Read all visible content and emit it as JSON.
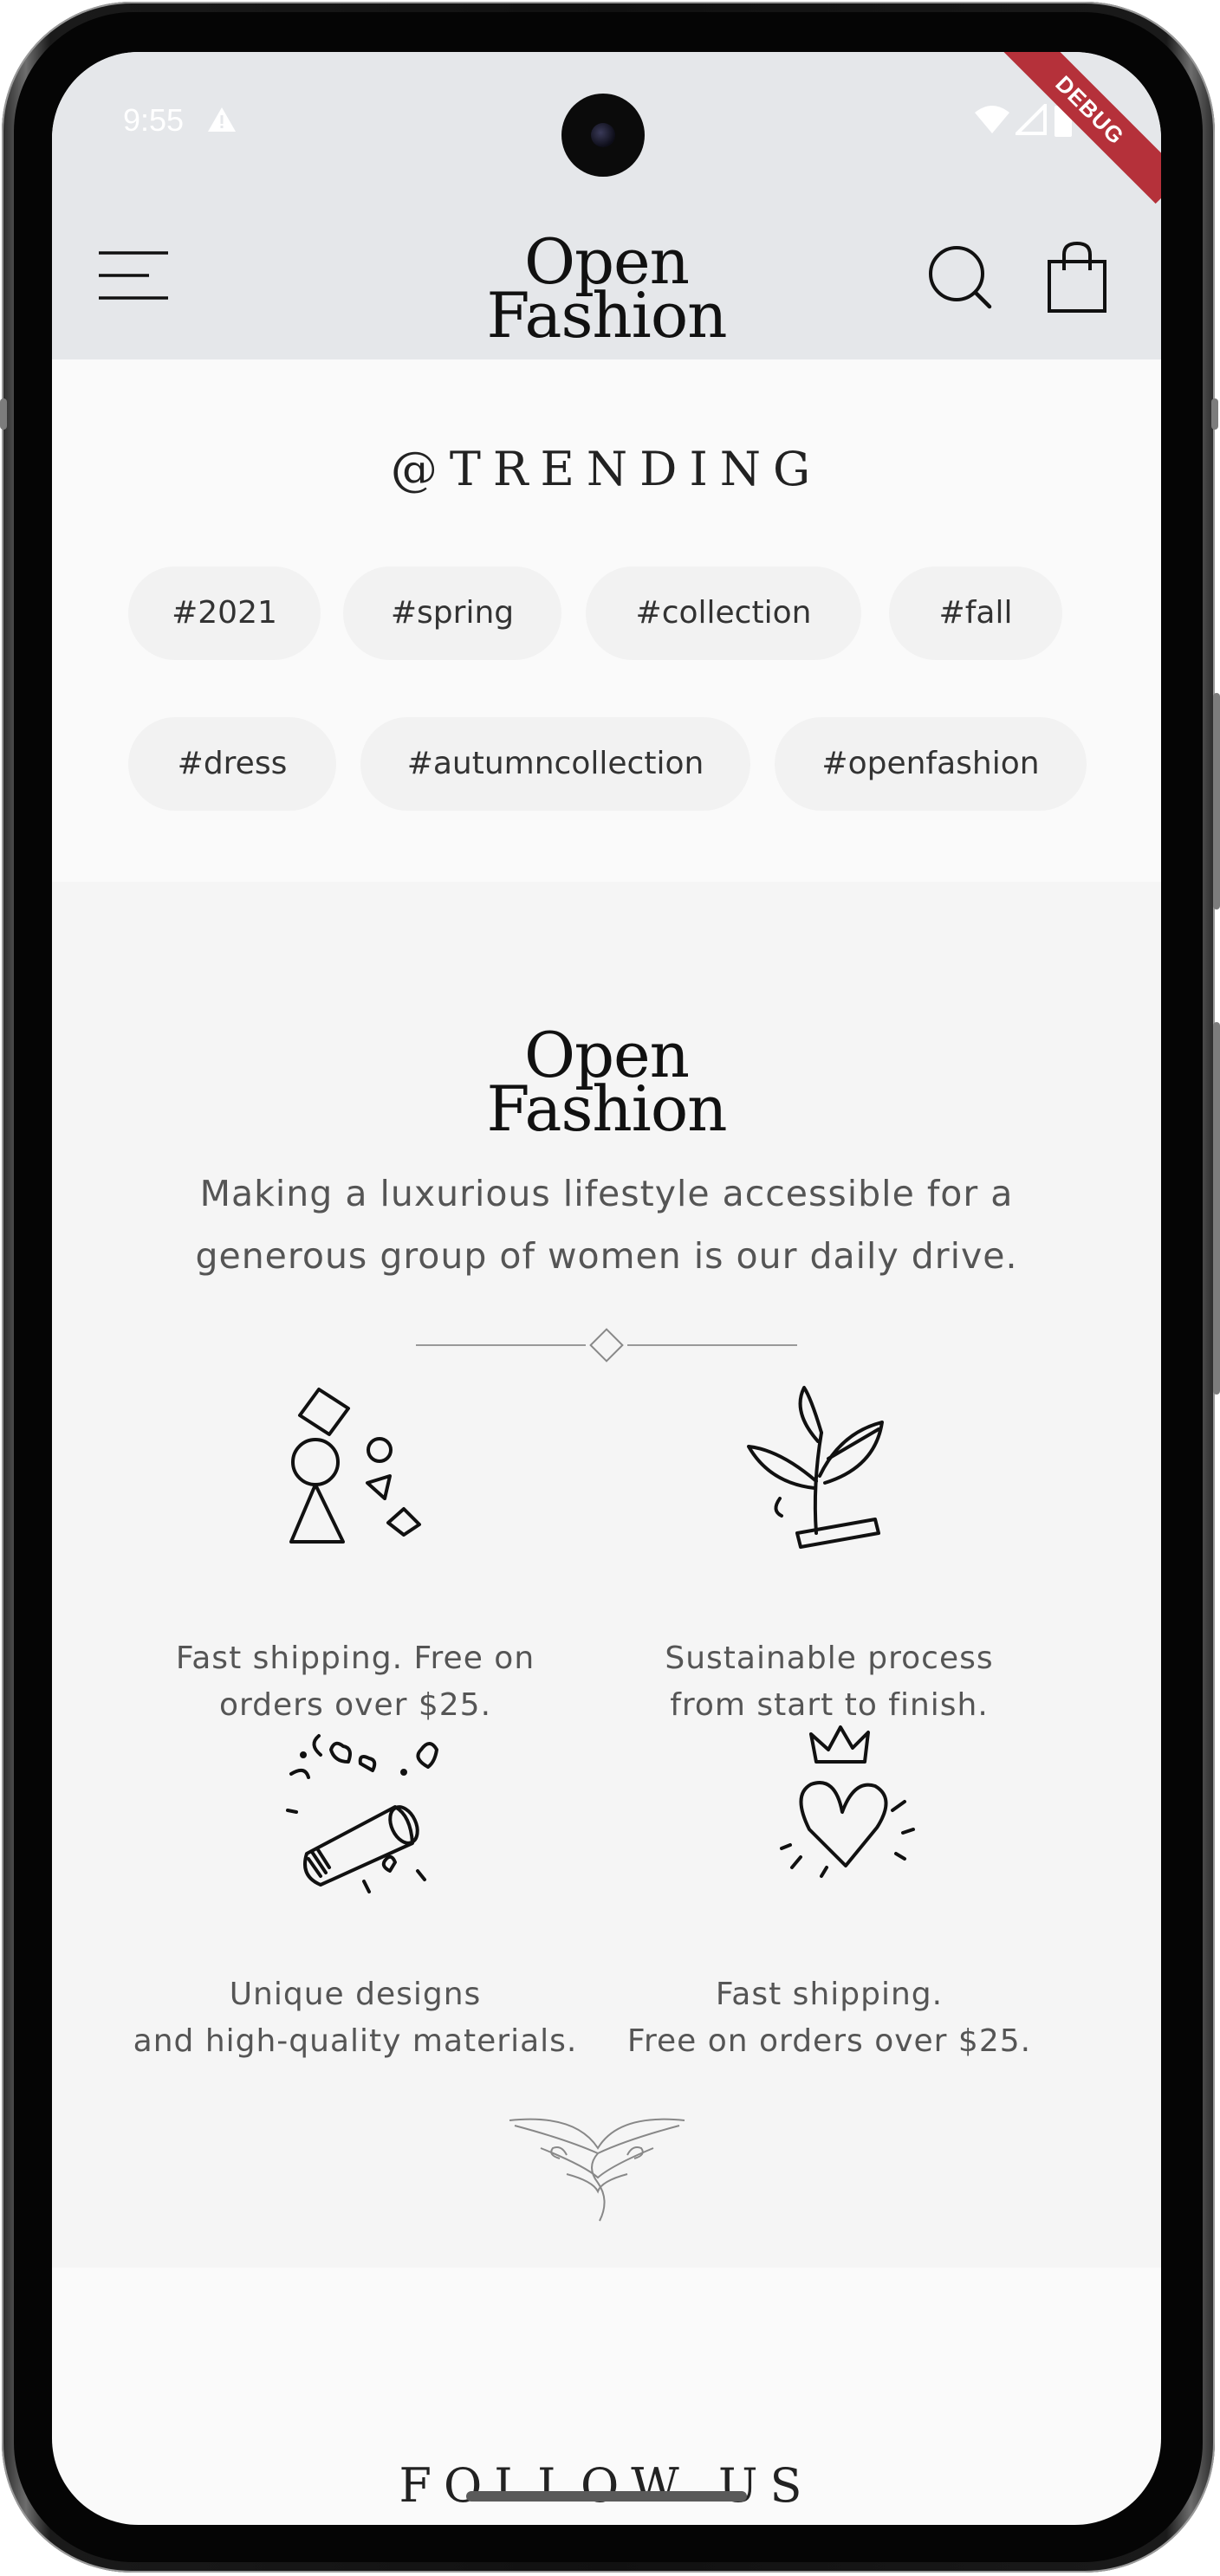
{
  "status_bar": {
    "time": "9:55",
    "debug_label": "DEBUG"
  },
  "header": {
    "logo_line1": "Open",
    "logo_line2": "Fashion",
    "icons": [
      "menu-icon",
      "search-icon",
      "shopping-bag-icon"
    ]
  },
  "trending": {
    "title": "@TRENDING",
    "tags": [
      "#2021",
      "#spring",
      "#collection",
      "#fall",
      "#dress",
      "#autumncollection",
      "#openfashion"
    ]
  },
  "brand": {
    "logo_line1": "Open",
    "logo_line2": "Fashion",
    "tagline": "Making a luxurious lifestyle accessible for a generous group of women is our daily drive.",
    "features": [
      {
        "icon": "geometric-shapes-icon",
        "text": "Fast shipping. Free on\norders over $25."
      },
      {
        "icon": "plant-sprout-icon",
        "text": "Sustainable process\nfrom start to finish."
      },
      {
        "icon": "confetti-popper-icon",
        "text": "Unique designs\nand high-quality materials."
      },
      {
        "icon": "crowned-heart-icon",
        "text": "Fast shipping.\nFree on orders over $25."
      }
    ]
  },
  "follow": {
    "title": "FOLLOW US"
  },
  "colors": {
    "header_bg": "#e5e7ea",
    "page_bg": "#fafafa",
    "section_bg": "#f5f5f5",
    "chip_bg": "#f2f2f2",
    "debug_ribbon": "#b5313a"
  }
}
